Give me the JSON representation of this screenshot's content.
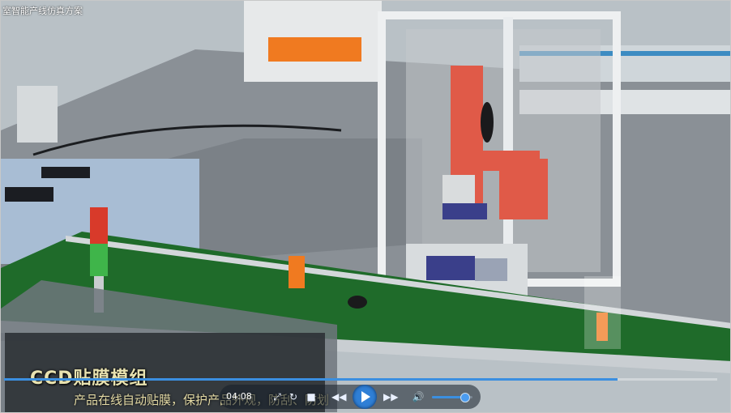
{
  "window": {
    "title": "室智能产线仿真方案"
  },
  "caption": {
    "title": "CCD贴膜模组",
    "subtitle": "产品在线自动贴膜，保护产品外观，防刮、防划"
  },
  "player": {
    "time": "04:08",
    "progress": 0.86,
    "volume": 0.8,
    "icons": {
      "refresh": "refresh-icon",
      "stop": "stop-icon",
      "prev": "rewind-icon",
      "play": "play-icon",
      "next": "fast-forward-icon",
      "volume": "speaker-icon"
    }
  },
  "colors": {
    "conveyor": "#1f6b2a",
    "robot": "#e05a48",
    "fixture": "#f07a20",
    "accent": "#2f7fd6"
  }
}
